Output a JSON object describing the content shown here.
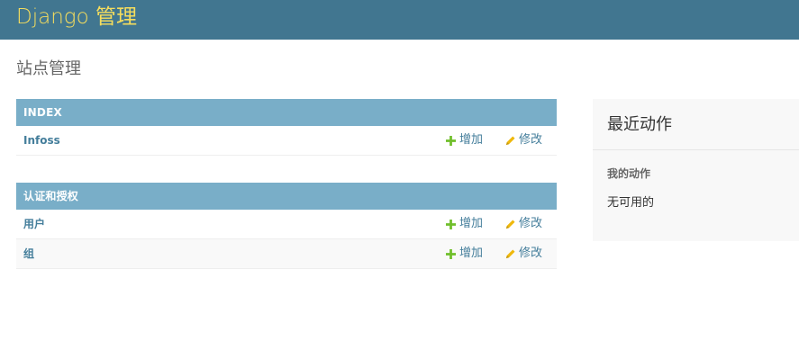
{
  "header": {
    "branding": "Django 管理"
  },
  "page_title": "站点管理",
  "modules": [
    {
      "caption": "INDEX",
      "models": [
        {
          "name": "Infoss",
          "add_label": "增加",
          "change_label": "修改"
        }
      ]
    },
    {
      "caption": "认证和授权",
      "models": [
        {
          "name": "用户",
          "add_label": "增加",
          "change_label": "修改"
        },
        {
          "name": "组",
          "add_label": "增加",
          "change_label": "修改"
        }
      ]
    }
  ],
  "recent_actions": {
    "title": "最近动作",
    "subtitle": "我的动作",
    "empty_text": "无可用的"
  },
  "colors": {
    "header_bg": "#417690",
    "branding": "#f5dd5d",
    "caption_bg": "#79aec8",
    "link": "#447e9b",
    "add_icon": "#70bf2b",
    "change_icon": "#efb80b"
  },
  "icons": {
    "add": "plus-icon",
    "change": "pencil-icon"
  }
}
